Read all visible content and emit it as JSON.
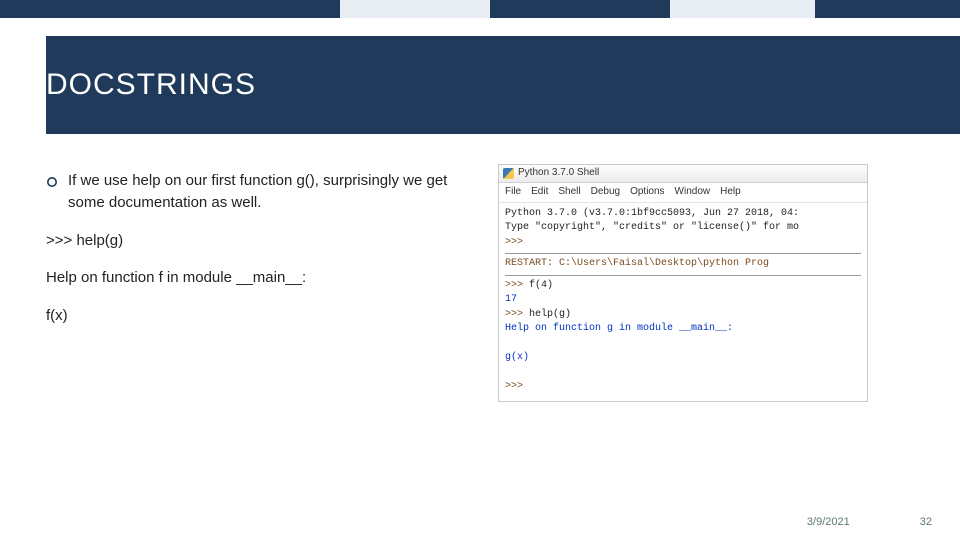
{
  "topbar": {
    "segments": [
      "dark",
      "light",
      "dark",
      "light",
      "dark"
    ]
  },
  "title": "DOCSTRINGS",
  "body": {
    "bullet": "If we use help on our first function g(), surprisingly we get some documentation as well.",
    "line_prompt": ">>> help(g)",
    "line_helpout": "Help on function f in module __main__:",
    "line_sig": "f(x)"
  },
  "shell": {
    "window_title": "Python 3.7.0 Shell",
    "menus": [
      "File",
      "Edit",
      "Shell",
      "Debug",
      "Options",
      "Window",
      "Help"
    ],
    "banner1": "Python 3.7.0 (v3.7.0:1bf9cc5093, Jun 27 2018, 04:",
    "banner2": "Type \"copyright\", \"credits\" or \"license()\" for mo",
    "prompt": ">>>",
    "restart": "RESTART: C:\\Users\\Faisal\\Desktop\\python Prog",
    "call1": "f(4)",
    "out1": "17",
    "call2": "help(g)",
    "helpout1": "Help on function g in module __main__:",
    "helpout2": "g(x)"
  },
  "footer": {
    "date": "3/9/2021",
    "page": "32"
  }
}
